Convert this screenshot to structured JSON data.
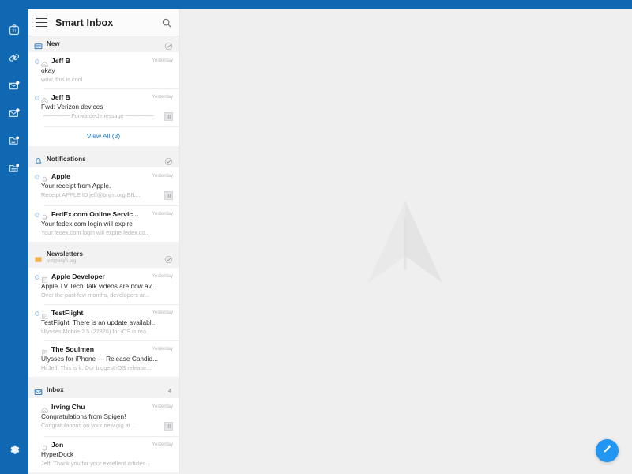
{
  "colors": {
    "rail_blue": "#1068b3",
    "accent_blue": "#1e7fd4",
    "fab_blue": "#2196f3",
    "list_bg": "#f2f2f3",
    "row_bg": "#ffffff",
    "main_bg": "#efeff0"
  },
  "rail": {
    "items": [
      {
        "name": "calendar-icon",
        "label": "Calendar"
      },
      {
        "name": "link-icon",
        "label": "Links"
      },
      {
        "name": "inbox-badge-icon",
        "label": "Inbox"
      },
      {
        "name": "mail-badge-icon",
        "label": "Mail"
      },
      {
        "name": "list-badge-icon",
        "label": "Lists"
      },
      {
        "name": "archive-badge-icon",
        "label": "Archive"
      }
    ],
    "settings": {
      "name": "gear-icon",
      "label": "Settings"
    }
  },
  "header": {
    "menu_icon": "hamburger-icon",
    "title": "Smart Inbox",
    "search_icon": "search-icon"
  },
  "groups": [
    {
      "id": "new",
      "title": "New",
      "subtitle": "",
      "icon": "new-mail-icon",
      "count": "",
      "has_check": true,
      "view_all": "View All (3)",
      "rows": [
        {
          "unread": true,
          "sender_icon": "envelope-open-icon",
          "sender": "Jeff B",
          "time": "Yesterday",
          "subject": "okay",
          "preview": "wow, this is cool",
          "attachment": false
        },
        {
          "unread": true,
          "sender_icon": "envelope-open-icon",
          "sender": "Jeff B",
          "time": "Yesterday",
          "subject": "Fwd: Verizon devices",
          "preview": "├────── Forwarded message ───────",
          "attachment": true
        }
      ]
    },
    {
      "id": "notifications",
      "title": "Notifications",
      "subtitle": "",
      "icon": "bell-icon",
      "count": "",
      "has_check": true,
      "view_all": "",
      "rows": [
        {
          "unread": true,
          "sender_icon": "bell-outline-icon",
          "sender": "Apple",
          "time": "Yesterday",
          "subject": "Your receipt from Apple.",
          "preview": "Receipt APPLE ID jeff@bnjm.org BIL...",
          "attachment": true
        },
        {
          "unread": true,
          "sender_icon": "bell-outline-icon",
          "sender": "FedEx.com Online Servic...",
          "time": "Yesterday",
          "subject": "Your fedex.com login will expire",
          "preview": "Your fedex.com login will expire fedex.co...",
          "attachment": false
        }
      ]
    },
    {
      "id": "newsletters",
      "title": "Newsletters",
      "subtitle": "jeff@bnjm.org",
      "icon": "newsletter-folder-icon",
      "count": "",
      "has_check": true,
      "view_all": "",
      "rows": [
        {
          "unread": true,
          "sender_icon": "newspaper-icon",
          "sender": "Apple Developer",
          "time": "Yesterday",
          "subject": "Apple TV Tech Talk videos are now av...",
          "preview": "Over the past few months, developers ar...",
          "attachment": false
        },
        {
          "unread": true,
          "sender_icon": "newspaper-icon",
          "sender": "TestFlight",
          "time": "Yesterday",
          "subject": "TestFlight: There is an update availabl...",
          "preview": "Ulysses Mobile 2.5 (27876) for iOS is rea...",
          "attachment": false
        },
        {
          "unread": false,
          "sender_icon": "newspaper-icon",
          "sender": "The Soulmen",
          "time": "Yesterday",
          "subject": "Ulysses for iPhone — Release Candid...",
          "preview": "Hi Jeff, This is it. Our biggest iOS release...",
          "attachment": false
        }
      ]
    },
    {
      "id": "inbox",
      "title": "Inbox",
      "subtitle": "",
      "icon": "inbox-tray-icon",
      "count": "4",
      "has_check": false,
      "view_all": "",
      "rows": [
        {
          "unread": false,
          "sender_icon": "envelope-open-icon",
          "sender": "Irving Chu",
          "time": "Yesterday",
          "subject": "Congratulations from Spigen!",
          "preview": "Congratulations on your new gig at...",
          "attachment": true
        },
        {
          "unread": false,
          "sender_icon": "bell-outline-icon",
          "sender": "Jon",
          "time": "Yesterday",
          "subject": "HyperDock",
          "preview": "Jeff, Thank you for your excellent articles...",
          "attachment": false
        }
      ]
    }
  ],
  "main": {
    "watermark_icon": "paper-plane-watermark",
    "compose": {
      "icon": "pencil-compose-icon",
      "label": "Compose"
    }
  }
}
